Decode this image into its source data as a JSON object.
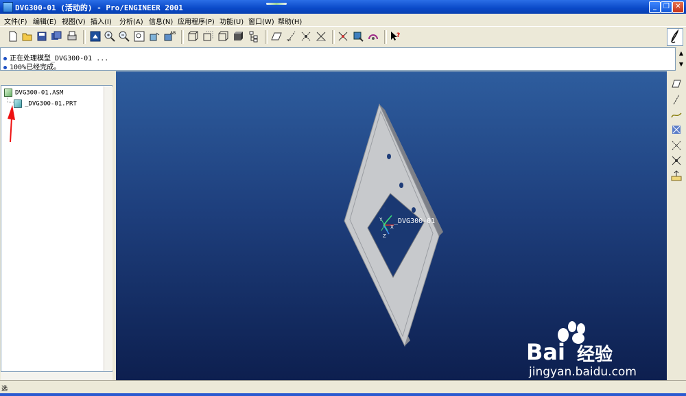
{
  "window": {
    "title": "DVG300-01 (活动的) - Pro/ENGINEER 2001",
    "minimize_glyph": "_",
    "maximize_glyph": "❐",
    "close_glyph": "✕"
  },
  "menu": {
    "items": [
      {
        "label": "文件(F)"
      },
      {
        "label": "编辑(E)"
      },
      {
        "label": "视图(V)"
      },
      {
        "label": "插入(I)"
      },
      {
        "label": "分析(A)"
      },
      {
        "label": "信息(N)"
      },
      {
        "label": "应用程序(P)"
      },
      {
        "label": "功能(U)"
      },
      {
        "label": "窗口(W)"
      },
      {
        "label": "帮助(H)"
      }
    ]
  },
  "toolbar": {
    "icons": [
      "new-file-icon",
      "open-file-icon",
      "save-icon",
      "save-copy-icon",
      "print-icon",
      "repaint-icon",
      "zoom-in-icon",
      "zoom-out-icon",
      "refit-icon",
      "orient-icon",
      "saved-views-icon",
      "wireframe-icon",
      "hidden-line-icon",
      "no-hidden-icon",
      "shading-icon",
      "model-tree-icon",
      "datum-plane-display-icon",
      "datum-axis-display-icon",
      "datum-point-display-icon",
      "coordinate-system-display-icon",
      "spin-center-icon",
      "select-icon",
      "appearance-icon",
      "context-help-icon"
    ]
  },
  "messages": {
    "lines": [
      "正在处理模型_DVG300-01 ...",
      "100%已经完成。"
    ]
  },
  "model_tree": {
    "root": "DVG300-01.ASM",
    "children": [
      "_DVG300-01.PRT"
    ]
  },
  "graphics": {
    "model_label": "_DVG300-01",
    "axis_labels": [
      "Y",
      "X",
      "Z"
    ],
    "watermark_brand": "Bai",
    "watermark_brand_suffix": "经验",
    "watermark_url": "jingyan.baidu.com",
    "background_top": "#2e5d9e",
    "background_bottom": "#0d1f4f"
  },
  "right_toolbar": {
    "icons": [
      "datum-plane-tool-icon",
      "datum-axis-tool-icon",
      "datum-curve-tool-icon",
      "datum-point-tool-icon",
      "sketched-point-icon",
      "offset-point-icon",
      "coordinate-system-tool-icon"
    ]
  },
  "status": {
    "text": "选"
  }
}
